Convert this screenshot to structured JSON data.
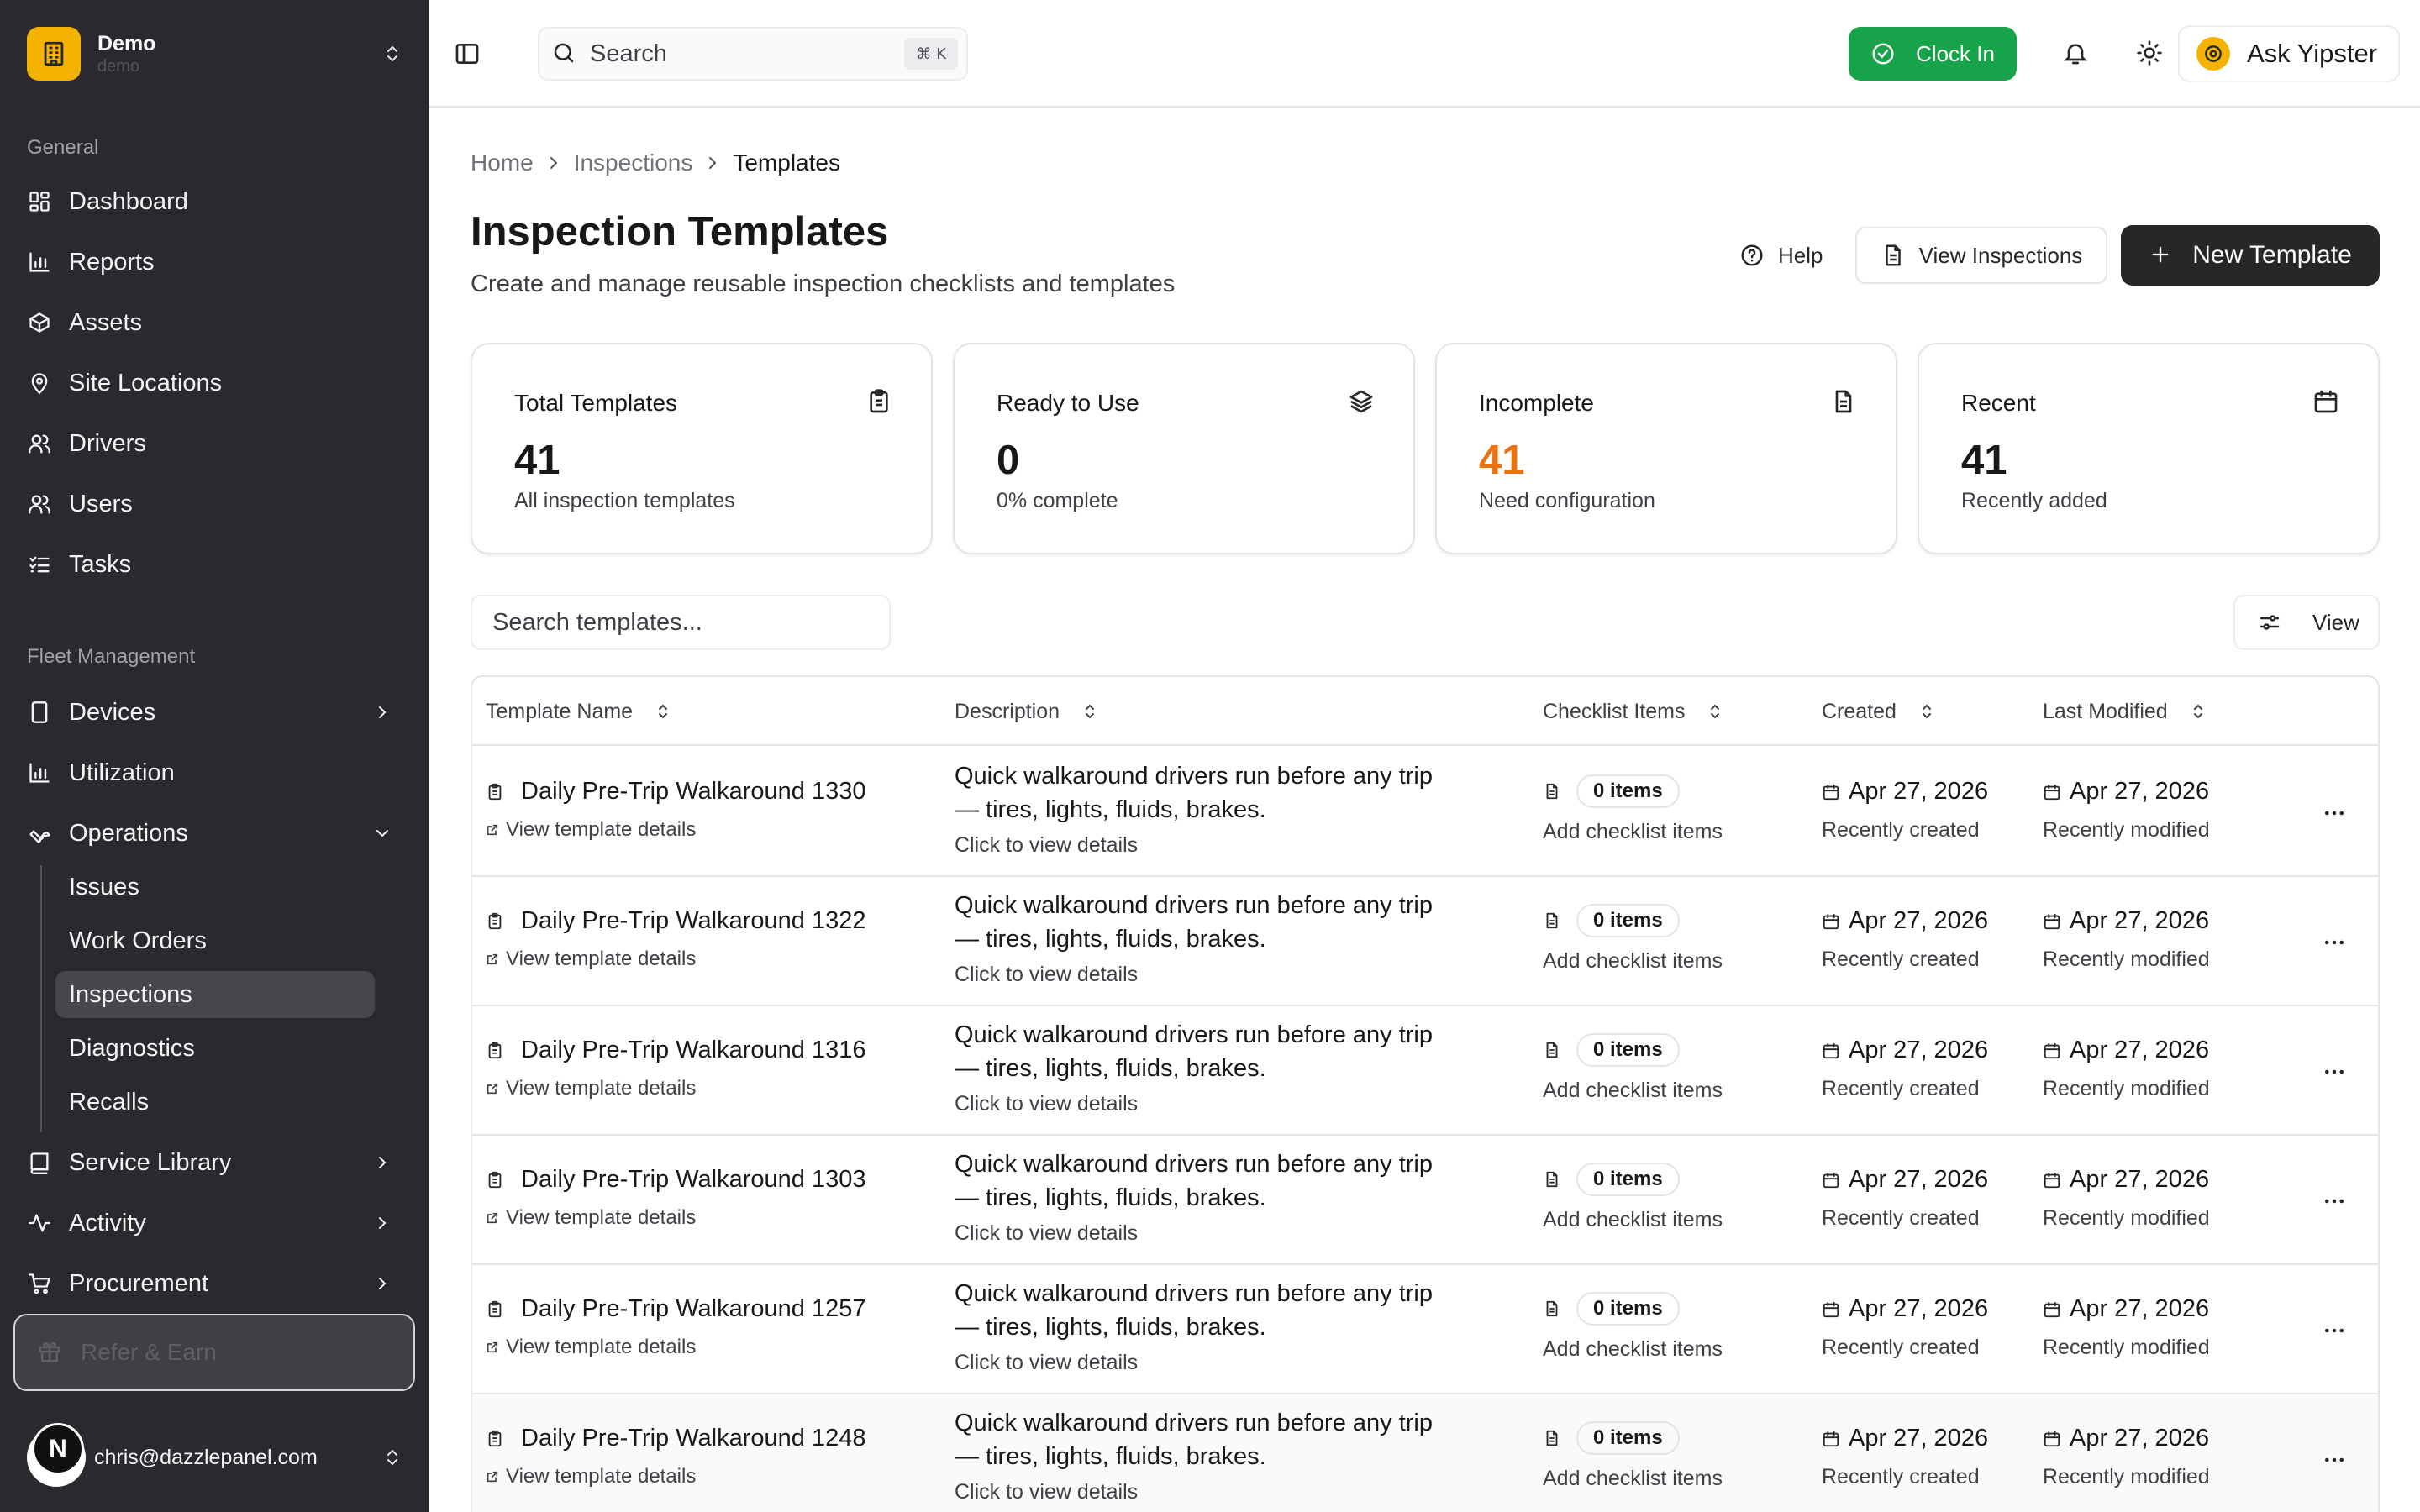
{
  "org": {
    "name": "Demo",
    "slug": "demo"
  },
  "sidebar": {
    "general_label": "General",
    "general": [
      {
        "label": "Dashboard",
        "icon": "dashboard-icon"
      },
      {
        "label": "Reports",
        "icon": "bar-chart-icon"
      },
      {
        "label": "Assets",
        "icon": "box-icon"
      },
      {
        "label": "Site Locations",
        "icon": "map-pin-icon"
      },
      {
        "label": "Drivers",
        "icon": "users-icon"
      },
      {
        "label": "Users",
        "icon": "users-icon"
      },
      {
        "label": "Tasks",
        "icon": "list-checks-icon"
      }
    ],
    "fleet_label": "Fleet Management",
    "fleet": [
      {
        "label": "Devices",
        "icon": "tablet-icon"
      },
      {
        "label": "Utilization",
        "icon": "bar-chart-icon"
      },
      {
        "label": "Operations",
        "icon": "wrench-icon"
      }
    ],
    "operations_sub": [
      {
        "label": "Issues"
      },
      {
        "label": "Work Orders"
      },
      {
        "label": "Inspections",
        "active": true
      },
      {
        "label": "Diagnostics"
      },
      {
        "label": "Recalls"
      }
    ],
    "more": [
      {
        "label": "Service Library",
        "icon": "book-icon"
      },
      {
        "label": "Activity",
        "icon": "activity-icon"
      },
      {
        "label": "Procurement",
        "icon": "cart-icon"
      }
    ],
    "refer_label": "Refer & Earn",
    "user_initial": "N",
    "user_email": "chris@dazzlepanel.com"
  },
  "topbar": {
    "search_placeholder": "Search",
    "search_shortcut": "⌘ K",
    "clock_in_label": "Clock In",
    "ask_label": "Ask Yipster",
    "clock_in_color": "#16a34a"
  },
  "breadcrumb": [
    "Home",
    "Inspections",
    "Templates"
  ],
  "page": {
    "title": "Inspection Templates",
    "subtitle": "Create and manage reusable inspection checklists and templates",
    "help_label": "Help",
    "view_inspections_label": "View Inspections",
    "new_template_label": "New Template"
  },
  "stats": [
    {
      "label": "Total Templates",
      "value": "41",
      "desc": "All inspection templates",
      "icon": "clipboard-icon"
    },
    {
      "label": "Ready to Use",
      "value": "0",
      "desc": "0% complete",
      "icon": "layers-icon"
    },
    {
      "label": "Incomplete",
      "value": "41",
      "desc": "Need configuration",
      "icon": "file-text-icon",
      "color": "#ea7210"
    },
    {
      "label": "Recent",
      "value": "41",
      "desc": "Recently added",
      "icon": "calendar-icon"
    }
  ],
  "table_toolbar": {
    "search_placeholder": "Search templates...",
    "view_label": "View"
  },
  "table": {
    "columns": [
      "Template Name",
      "Description",
      "Checklist Items",
      "Created",
      "Last Modified"
    ],
    "link_label": "View template details",
    "desc_cta": "Click to view details",
    "items_cta": "Add checklist items",
    "created_sub": "Recently created",
    "modified_sub": "Recently modified",
    "rows": [
      {
        "name": "Daily Pre-Trip Walkaround 1330",
        "description": "Quick walkaround drivers run before any trip — tires, lights, fluids, brakes.",
        "items": "0 items",
        "created": "Apr 27, 2026",
        "modified": "Apr 27, 2026"
      },
      {
        "name": "Daily Pre-Trip Walkaround 1322",
        "description": "Quick walkaround drivers run before any trip — tires, lights, fluids, brakes.",
        "items": "0 items",
        "created": "Apr 27, 2026",
        "modified": "Apr 27, 2026"
      },
      {
        "name": "Daily Pre-Trip Walkaround 1316",
        "description": "Quick walkaround drivers run before any trip — tires, lights, fluids, brakes.",
        "items": "0 items",
        "created": "Apr 27, 2026",
        "modified": "Apr 27, 2026"
      },
      {
        "name": "Daily Pre-Trip Walkaround 1303",
        "description": "Quick walkaround drivers run before any trip — tires, lights, fluids, brakes.",
        "items": "0 items",
        "created": "Apr 27, 2026",
        "modified": "Apr 27, 2026"
      },
      {
        "name": "Daily Pre-Trip Walkaround 1257",
        "description": "Quick walkaround drivers run before any trip — tires, lights, fluids, brakes.",
        "items": "0 items",
        "created": "Apr 27, 2026",
        "modified": "Apr 27, 2026"
      },
      {
        "name": "Daily Pre-Trip Walkaround 1248",
        "description": "Quick walkaround drivers run before any trip — tires, lights, fluids, brakes.",
        "items": "0 items",
        "created": "Apr 27, 2026",
        "modified": "Apr 27, 2026"
      }
    ]
  }
}
